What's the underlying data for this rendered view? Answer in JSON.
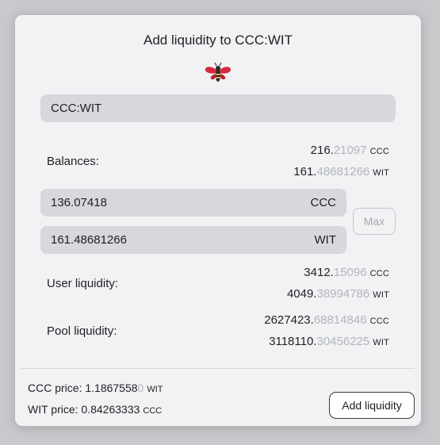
{
  "dialog": {
    "title": "Add liquidity to CCC:WIT",
    "logo_icon": "bee-icon",
    "pair": "CCC:WIT"
  },
  "balances": {
    "label": "Balances:",
    "ccc": {
      "main": "216.",
      "fade": "21097",
      "unit": "CCC"
    },
    "wit": {
      "main": "161.",
      "fade": "48681266",
      "unit": "WIT"
    }
  },
  "inputs": {
    "ccc_value": "136.07418",
    "ccc_unit": "CCC",
    "wit_value": "161.48681266",
    "wit_unit": "WIT",
    "max_label": "Max"
  },
  "user_liquidity": {
    "label": "User liquidity:",
    "ccc": {
      "main": "3412.",
      "fade": "15096",
      "unit": "CCC"
    },
    "wit": {
      "main": "4049.",
      "fade": "38994786",
      "unit": "WIT"
    }
  },
  "pool_liquidity": {
    "label": "Pool liquidity:",
    "ccc": {
      "main": "2627423.",
      "fade": "68814846",
      "unit": "CCC"
    },
    "wit": {
      "main": "3118110.",
      "fade": "30456225",
      "unit": "WIT"
    }
  },
  "footer": {
    "ccc_price_label": "CCC price: ",
    "ccc_price_main": "1.1867558",
    "ccc_price_fade": "0",
    "ccc_price_unit": "WIT",
    "wit_price_label": "WIT price: ",
    "wit_price_main": "0.84263333",
    "wit_price_unit": "CCC",
    "add_button": "Add liquidity"
  },
  "colors": {
    "accent_red": "#d6283c",
    "panel": "#f1f2f4",
    "field": "#d6d8dc"
  }
}
